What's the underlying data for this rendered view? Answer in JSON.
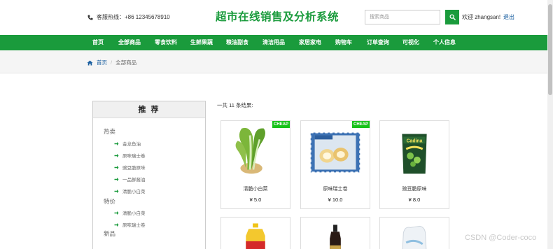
{
  "header": {
    "hotline": "客服热线：+86 12345678910",
    "title": "超市在线销售及分析系统",
    "search_placeholder": "搜索商品",
    "welcome": "欢迎 zhangsan!",
    "logout": "退出",
    "brand_color": "#1a9b3c"
  },
  "nav": {
    "items": [
      {
        "label": "首页"
      },
      {
        "label": "全部商品"
      },
      {
        "label": "零食饮料"
      },
      {
        "label": "生鲜果蔬"
      },
      {
        "label": "粮油副食"
      },
      {
        "label": "清洁用品"
      },
      {
        "label": "家居家电"
      },
      {
        "label": "购物车"
      },
      {
        "label": "订单查询"
      },
      {
        "label": "可视化"
      },
      {
        "label": "个人信息"
      }
    ]
  },
  "breadcrumb": {
    "home": "首页",
    "separator": "/",
    "current": "全部商品"
  },
  "sidebar": {
    "title": "推 荐",
    "hot_label": "热卖",
    "hot_items": [
      "金龙鱼油",
      "原味瑞士卷",
      "豌豆脆原味",
      "一品鲜酱油",
      "清脆小白菜"
    ],
    "special_label": "特价",
    "special_items": [
      "清脆小白菜",
      "原味瑞士卷"
    ],
    "new_label": "新品"
  },
  "results": {
    "summary": "一共 11 条结果:",
    "badge_text": "CHEAP",
    "products": [
      {
        "name": "清脆小白菜",
        "price": "¥ 5.0",
        "badge": true,
        "icon": "bok-choy-image"
      },
      {
        "name": "原味瑞士卷",
        "price": "¥ 10.0",
        "badge": true,
        "icon": "swiss-roll-image"
      },
      {
        "name": "豌豆脆原味",
        "price": "¥ 8.0",
        "badge": false,
        "icon": "pea-snack-image"
      },
      {
        "name": "",
        "price": "",
        "badge": false,
        "icon": "cooking-oil-image"
      },
      {
        "name": "",
        "price": "",
        "badge": false,
        "icon": "soy-sauce-image"
      },
      {
        "name": "",
        "price": "",
        "badge": false,
        "icon": "product-bag-image"
      }
    ]
  },
  "watermark": "CSDN @Coder-coco"
}
